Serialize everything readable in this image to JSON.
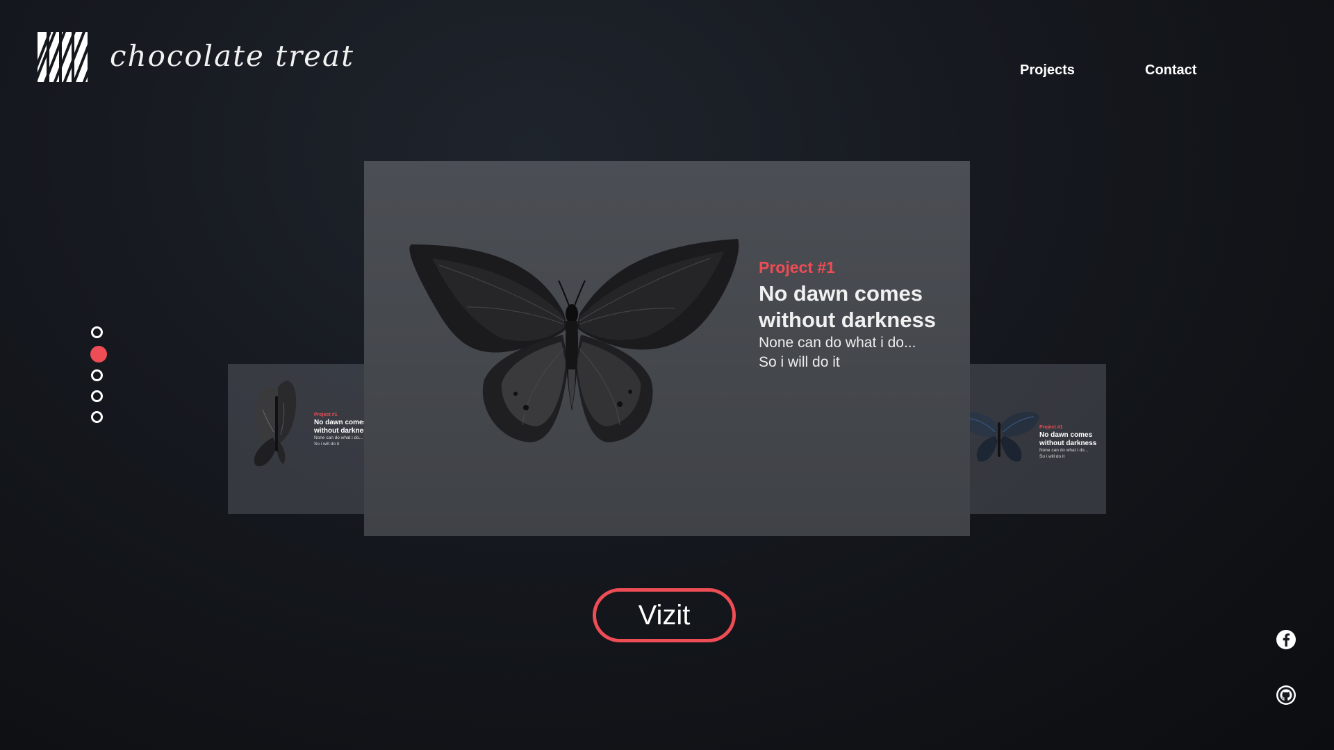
{
  "brand": {
    "name": "chocolate treat",
    "logo_icon": "striped-square-logo"
  },
  "nav": {
    "projects": "Projects",
    "contact": "Contact"
  },
  "pager": {
    "count": 5,
    "active_index": 1
  },
  "main_card": {
    "tag": "Project #1",
    "title_line1": "No dawn comes",
    "title_line2": "without darkness",
    "sub_line1": "None can do what i do...",
    "sub_line2": "So i will do it"
  },
  "left_card": {
    "tag": "Project #1",
    "title_line1": "No dawn comes",
    "title_line2": "without darkness",
    "sub_line1": "None can do what i do...",
    "sub_line2": "So i will do it"
  },
  "right_card": {
    "tag": "Project #1",
    "title_line1": "No dawn comes",
    "title_line2": "without darkness",
    "sub_line1": "None can do what i do...",
    "sub_line2": "So i will do it"
  },
  "cta": {
    "label": "Vizit"
  },
  "social": {
    "facebook_icon": "facebook-icon",
    "github_icon": "github-icon"
  },
  "colors": {
    "accent": "#ee4d55",
    "background": "#15181e",
    "card": "#474a50"
  }
}
